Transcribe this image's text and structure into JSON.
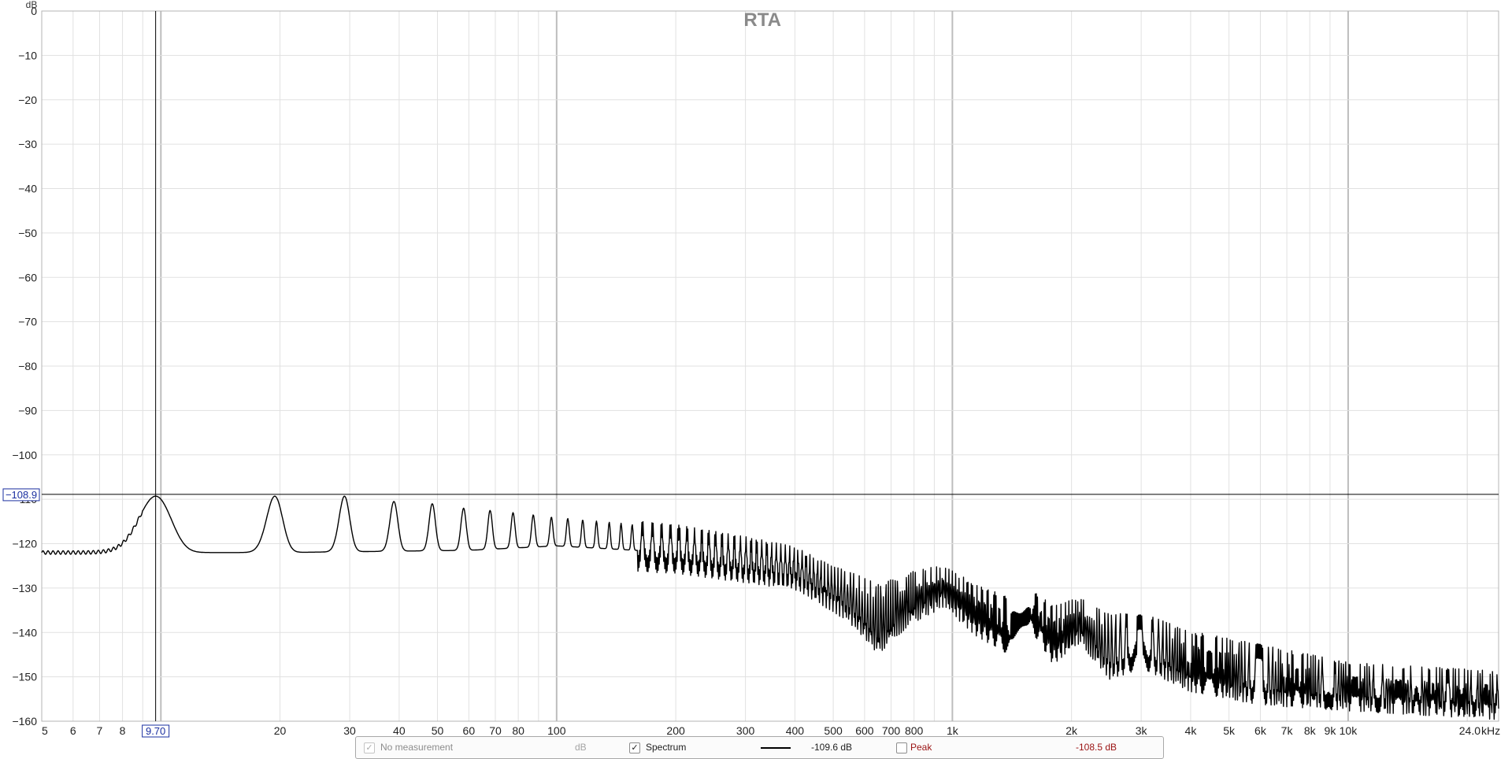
{
  "chart_data": {
    "type": "line",
    "title": "RTA",
    "ylabel": "dB",
    "xunit": "kHz",
    "x_scale": "log",
    "xlim": [
      5,
      24000
    ],
    "ylim": [
      -160,
      0
    ],
    "grid": true,
    "y_ticks": [
      "0",
      "-10",
      "-20",
      "-30",
      "-40",
      "-50",
      "-60",
      "-70",
      "-80",
      "-90",
      "-100",
      "-110",
      "-120",
      "-130",
      "-140",
      "-150",
      "-160"
    ],
    "x_ticks": [
      {
        "v": 5,
        "label": "5"
      },
      {
        "v": 6,
        "label": "6"
      },
      {
        "v": 7,
        "label": "7"
      },
      {
        "v": 8,
        "label": "8"
      },
      {
        "v": 20,
        "label": "20"
      },
      {
        "v": 30,
        "label": "30"
      },
      {
        "v": 40,
        "label": "40"
      },
      {
        "v": 50,
        "label": "50"
      },
      {
        "v": 60,
        "label": "60"
      },
      {
        "v": 70,
        "label": "70"
      },
      {
        "v": 80,
        "label": "80"
      },
      {
        "v": 100,
        "label": "100"
      },
      {
        "v": 200,
        "label": "200"
      },
      {
        "v": 300,
        "label": "300"
      },
      {
        "v": 400,
        "label": "400"
      },
      {
        "v": 500,
        "label": "500"
      },
      {
        "v": 600,
        "label": "600"
      },
      {
        "v": 700,
        "label": "700"
      },
      {
        "v": 800,
        "label": "800"
      },
      {
        "v": 1000,
        "label": "1k"
      },
      {
        "v": 2000,
        "label": "2k"
      },
      {
        "v": 3000,
        "label": "3k"
      },
      {
        "v": 4000,
        "label": "4k"
      },
      {
        "v": 5000,
        "label": "5k"
      },
      {
        "v": 6000,
        "label": "6k"
      },
      {
        "v": 7000,
        "label": "7k"
      },
      {
        "v": 8000,
        "label": "8k"
      },
      {
        "v": 9000,
        "label": "9k"
      },
      {
        "v": 10000,
        "label": "10k"
      },
      {
        "v": 24000,
        "label": "24.0"
      }
    ],
    "x_major_gridlines": [
      10,
      100,
      1000,
      10000
    ],
    "cursor": {
      "x": 9.7,
      "x_label": "9.70",
      "y": -108.9,
      "y_label": "-108.9"
    },
    "series": [
      {
        "name": "Spectrum",
        "color": "#000000",
        "harmonic_fundamental": 9.7,
        "floor_points": [
          [
            5,
            -122
          ],
          [
            7,
            -122
          ],
          [
            9,
            -122
          ],
          [
            20,
            -122
          ],
          [
            60,
            -121.5
          ],
          [
            100,
            -120.5
          ],
          [
            200,
            -122
          ],
          [
            400,
            -126
          ],
          [
            550,
            -133
          ],
          [
            650,
            -139
          ],
          [
            800,
            -133
          ],
          [
            950,
            -130
          ],
          [
            1150,
            -136
          ],
          [
            1400,
            -140
          ],
          [
            1600,
            -136
          ],
          [
            1800,
            -142
          ],
          [
            2100,
            -138
          ],
          [
            2500,
            -145
          ],
          [
            3000,
            -143
          ],
          [
            4000,
            -148
          ],
          [
            6000,
            -151
          ],
          [
            10000,
            -153
          ],
          [
            24000,
            -155
          ]
        ],
        "harmonic_peaks": [
          [
            9.7,
            -109.3
          ],
          [
            19.4,
            -109.3
          ],
          [
            29.1,
            -109.3
          ],
          [
            38.8,
            -110.5
          ],
          [
            48.5,
            -111
          ],
          [
            58.2,
            -112
          ],
          [
            67.9,
            -112.5
          ],
          [
            77.6,
            -113
          ],
          [
            87.3,
            -113.5
          ],
          [
            97,
            -114
          ],
          [
            150,
            -115.5
          ],
          [
            200,
            -117
          ],
          [
            300,
            -120
          ],
          [
            400,
            -123
          ],
          [
            500,
            -127
          ],
          [
            900,
            -127
          ],
          [
            1500,
            -133
          ],
          [
            2200,
            -134
          ],
          [
            2800,
            -135
          ],
          [
            4000,
            -139
          ],
          [
            6000,
            -142
          ],
          [
            10000,
            -148
          ],
          [
            24000,
            -150
          ]
        ]
      }
    ]
  },
  "legend": {
    "measurement_label": "No measurement",
    "measurement_value": "dB",
    "spectrum_label": "Spectrum",
    "spectrum_value": "-109.6 dB",
    "peak_label": "Peak",
    "peak_value": "-108.5 dB",
    "peak_color": "#9a1212"
  }
}
